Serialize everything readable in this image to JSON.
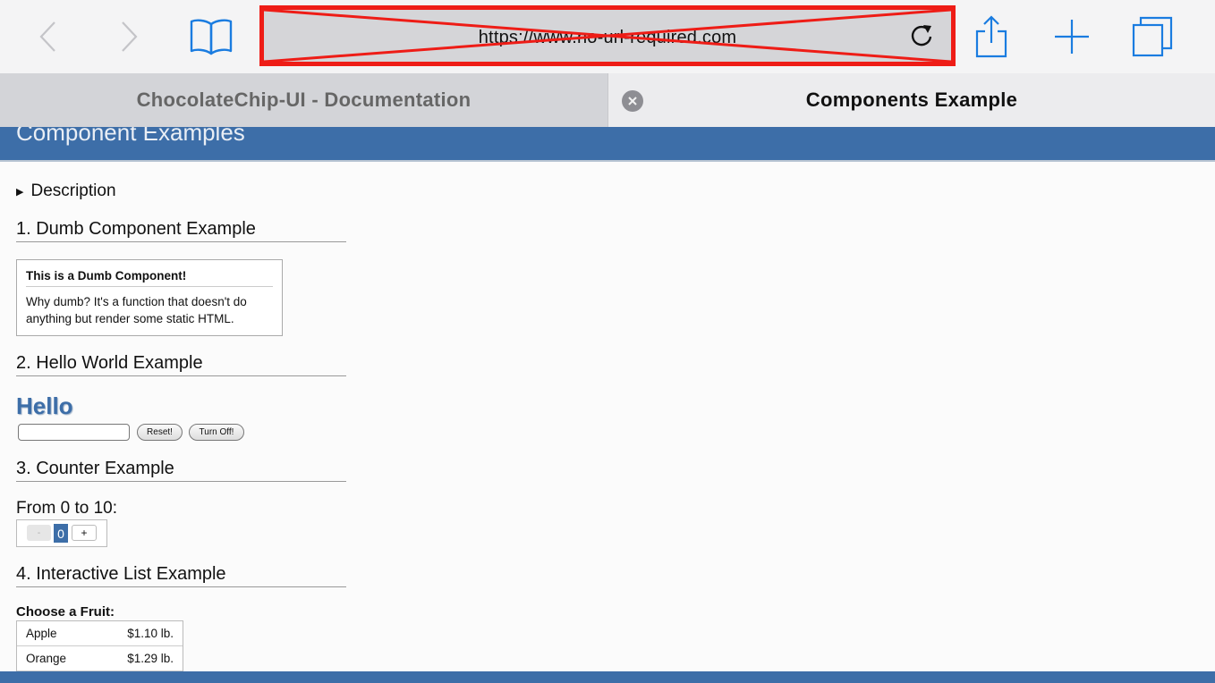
{
  "browser": {
    "url": "https://www.no-url-required.com",
    "icons": {
      "back": "chevron-left-icon",
      "forward": "chevron-right-icon",
      "bookmarks": "book-icon",
      "reload": "reload-icon",
      "share": "share-icon",
      "new_tab": "plus-icon",
      "tabs": "tabs-icon"
    },
    "accent_color": "#1a7ce0",
    "redaction_color": "#ee1c16"
  },
  "tabs": [
    {
      "title": "ChocolateChip-UI - Documentation",
      "active": false
    },
    {
      "title": "Components Example",
      "active": true
    }
  ],
  "page": {
    "banner_title": "Component Examples",
    "banner_color": "#3d6ea8",
    "description_label": "Description",
    "sections": [
      {
        "heading": "1. Dumb Component Example"
      },
      {
        "heading": "2. Hello World Example"
      },
      {
        "heading": "3. Counter Example"
      },
      {
        "heading": "4. Interactive List Example"
      }
    ],
    "dumb": {
      "title": "This is a Dumb Component!",
      "text": "Why dumb? It's a function that doesn't do anything but render some static HTML."
    },
    "hello": {
      "heading": "Hello",
      "input_value": "",
      "reset_label": "Reset!",
      "turn_off_label": "Turn Off!"
    },
    "counter": {
      "label": "From 0 to 10:",
      "minus_label": "-",
      "value": "0",
      "plus_label": "+"
    },
    "fruit": {
      "label": "Choose a Fruit:",
      "items": [
        {
          "name": "Apple",
          "price": "$1.10 lb."
        },
        {
          "name": "Orange",
          "price": "$1.29 lb."
        }
      ]
    }
  }
}
